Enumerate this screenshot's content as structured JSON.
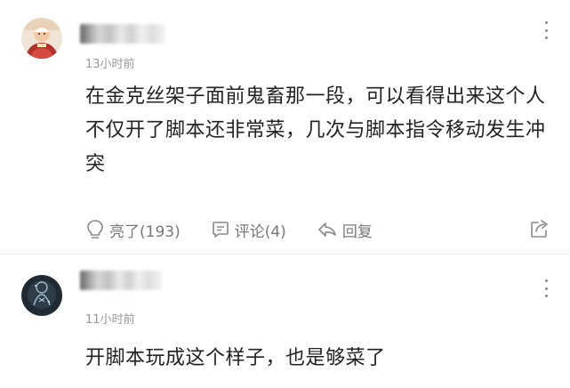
{
  "comments": [
    {
      "time": "13小时前",
      "text": "在金克丝架子面前鬼畜那一段，可以看得出来这个人不仅开了脚本还非常菜，几次与脚本指令移动发生冲突",
      "actions": {
        "like_label": "亮了(193)",
        "reply_count_label": "评论(4)",
        "reply_label": "回复"
      },
      "icons": [
        "avatar",
        "more-icon",
        "lightbulb-icon",
        "comment-icon",
        "reply-icon",
        "share-icon"
      ]
    },
    {
      "time": "11小时前",
      "text": "开脚本玩成这个样子，也是够菜了",
      "icons": [
        "avatar",
        "more-icon"
      ]
    }
  ],
  "colors": {
    "text": "#222222",
    "meta": "#999999",
    "action": "#777777",
    "divider": "#eeeeee"
  }
}
